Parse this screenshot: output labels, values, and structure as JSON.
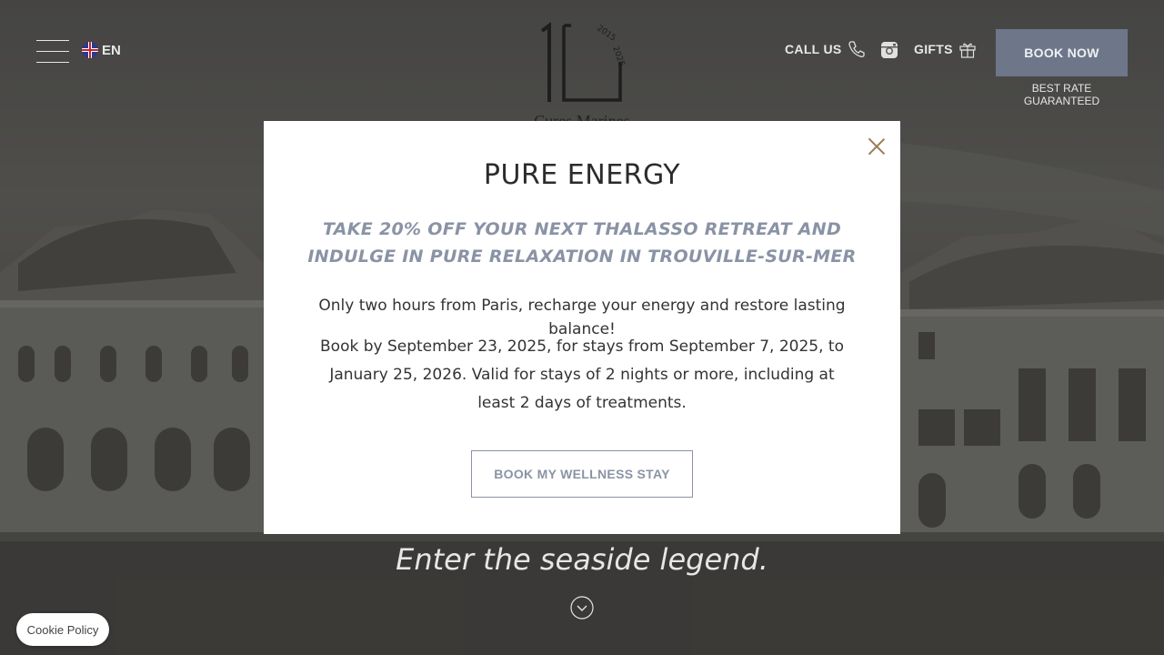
{
  "header": {
    "menu_icon": "hamburger-menu-icon",
    "language": {
      "code": "EN",
      "icon": "uk-flag-icon"
    },
    "logo": {
      "numeral": "10",
      "years": "2015 · 2025",
      "brand": "Cures Marines"
    },
    "call_us": {
      "label": "CALL US",
      "icon": "phone-icon"
    },
    "instagram": {
      "icon": "instagram-icon"
    },
    "gifts": {
      "label": "GIFTS",
      "icon": "gift-icon"
    },
    "book_now": {
      "label": "BOOK NOW"
    },
    "best_rate": "BEST RATE GUARANTEED"
  },
  "hero": {
    "tagline": "Enter the seaside legend.",
    "scroll_icon": "chevron-down-circle-icon"
  },
  "modal": {
    "title": "PURE ENERGY",
    "subtitle": "TAKE 20% OFF YOUR NEXT THALASSO RETREAT AND INDULGE IN PURE RELAXATION IN TROUVILLE-SUR-MER",
    "paragraph1": "Only two hours from Paris, recharge your energy and restore lasting balance!",
    "paragraph2": "Book by September 23, 2025, for stays from September 7, 2025, to January 25, 2026. Valid for stays of 2 nights or more, including at least 2 days of treatments.",
    "cta": "BOOK MY WELLNESS STAY",
    "close_icon": "close-icon"
  },
  "cookie": {
    "label": "Cookie Policy"
  },
  "colors": {
    "accent": "#6d7789",
    "subtitle": "#8a93a5",
    "close": "#9a7d52"
  }
}
